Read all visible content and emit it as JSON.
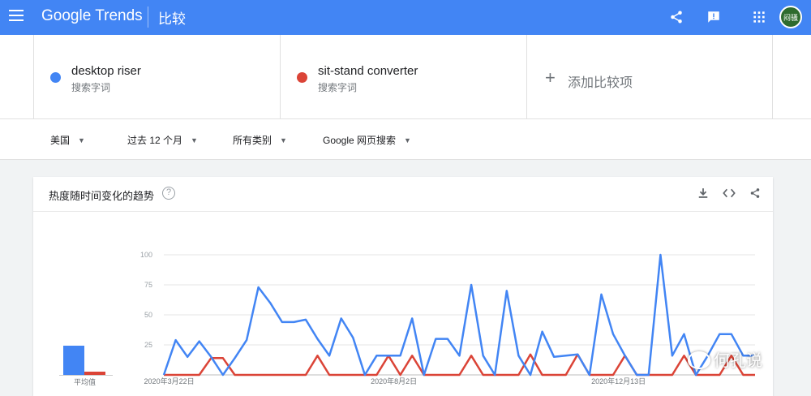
{
  "topbar": {
    "logo_google": "Google",
    "logo_trends": "Trends",
    "page_title": "比较",
    "avatar_text": "闷骚"
  },
  "terms": [
    {
      "name": "desktop riser",
      "sub": "搜索字词",
      "color": "#4285f4"
    },
    {
      "name": "sit-stand converter",
      "sub": "搜索字词",
      "color": "#db4437"
    }
  ],
  "add_term": {
    "label": "添加比较项"
  },
  "filters": {
    "region": "美国",
    "time": "过去 12 个月",
    "category": "所有类别",
    "search_type": "Google 网页搜索"
  },
  "card": {
    "title": "热度随时间变化的趋势",
    "help": "?"
  },
  "average": {
    "label": "平均值",
    "values": [
      27,
      3
    ]
  },
  "chart_data": {
    "type": "line",
    "ylim": [
      0,
      100
    ],
    "yticks": [
      25,
      50,
      75,
      100
    ],
    "xtick_labels": [
      "2020年3月22日",
      "2020年8月2日",
      "2020年12月13日"
    ],
    "xtick_index": [
      1,
      20,
      39
    ],
    "series": [
      {
        "name": "desktop riser",
        "color": "#4285f4",
        "values": [
          0,
          29,
          15,
          28,
          15,
          0,
          14,
          29,
          73,
          60,
          44,
          44,
          46,
          30,
          16,
          47,
          31,
          0,
          16,
          16,
          16,
          47,
          0,
          30,
          30,
          16,
          75,
          16,
          0,
          70,
          16,
          0,
          36,
          15,
          16,
          17,
          0,
          67,
          34,
          16,
          0,
          0,
          100,
          16,
          34,
          0,
          16,
          34,
          34,
          16,
          16
        ]
      },
      {
        "name": "sit-stand converter",
        "color": "#db4437",
        "values": [
          0,
          0,
          0,
          0,
          14,
          14,
          0,
          0,
          0,
          0,
          0,
          0,
          0,
          16,
          0,
          0,
          0,
          0,
          0,
          16,
          0,
          16,
          0,
          0,
          0,
          0,
          16,
          0,
          0,
          0,
          0,
          17,
          0,
          0,
          0,
          17,
          0,
          0,
          0,
          16,
          0,
          0,
          0,
          0,
          16,
          0,
          0,
          0,
          16,
          0,
          0
        ]
      }
    ]
  },
  "watermark": {
    "text": "何孔说"
  }
}
